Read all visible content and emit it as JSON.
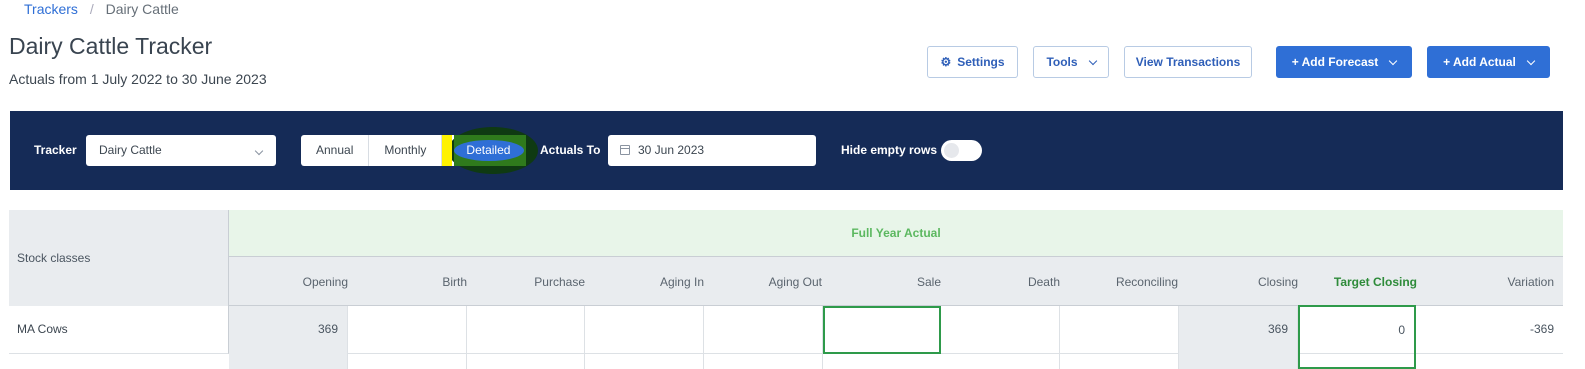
{
  "breadcrumb": {
    "parent": "Trackers",
    "separator": "/",
    "current": "Dairy Cattle"
  },
  "page": {
    "title": "Dairy Cattle Tracker",
    "subtitle": "Actuals from 1 July 2022 to 30 June 2023"
  },
  "actions": {
    "settings": "Settings",
    "tools": "Tools",
    "view_transactions": "View Transactions",
    "add_forecast": "+ Add Forecast",
    "add_actual": "+ Add Actual"
  },
  "toolbar": {
    "tracker_label": "Tracker",
    "tracker_value": "Dairy Cattle",
    "views": [
      "Annual",
      "Monthly",
      "Detailed"
    ],
    "active_view": "Detailed",
    "actuals_to_label": "Actuals To",
    "actuals_to_value": "30 Jun 2023",
    "hide_empty_label": "Hide empty rows",
    "hide_empty_on": false
  },
  "colors": {
    "navy": "#152b57",
    "primary": "#2f6fd6",
    "green": "#2e8b3a",
    "band": "#e8f5e9"
  },
  "table": {
    "stock_classes_label": "Stock classes",
    "group_header": "Full Year Actual",
    "columns": [
      "Opening",
      "Birth",
      "Purchase",
      "Aging In",
      "Aging Out",
      "Sale",
      "Death",
      "Reconciling",
      "Closing",
      "Target Closing",
      "Variation"
    ],
    "rows": [
      {
        "label": "MA Cows",
        "values": [
          "369",
          "",
          "",
          "",
          "",
          "",
          "",
          "",
          "369",
          "0",
          "-369"
        ]
      }
    ]
  }
}
